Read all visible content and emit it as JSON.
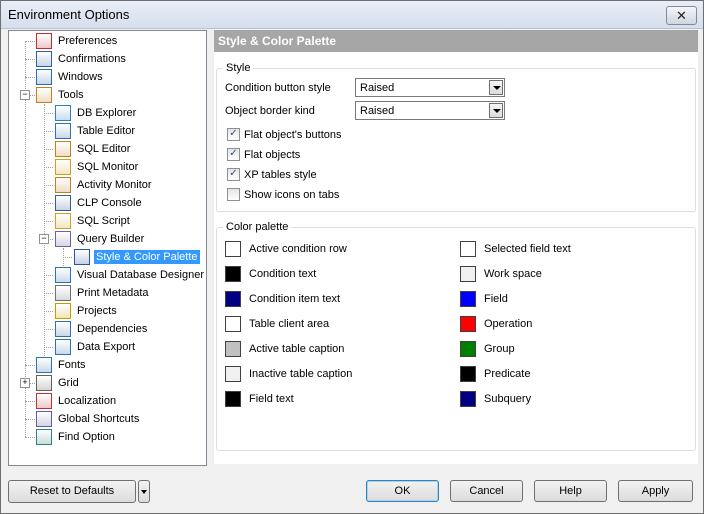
{
  "window": {
    "title": "Environment Options",
    "close_glyph": "✕"
  },
  "tree": {
    "items": [
      {
        "label": "Preferences",
        "icon": "preferences-icon"
      },
      {
        "label": "Confirmations",
        "icon": "confirmations-icon"
      },
      {
        "label": "Windows",
        "icon": "windows-icon"
      },
      {
        "label": "Tools",
        "icon": "tools-icon",
        "expanded": true
      },
      {
        "label": "DB Explorer",
        "icon": "db-explorer-icon"
      },
      {
        "label": "Table Editor",
        "icon": "table-editor-icon"
      },
      {
        "label": "SQL Editor",
        "icon": "sql-editor-icon"
      },
      {
        "label": "SQL Monitor",
        "icon": "sql-monitor-icon"
      },
      {
        "label": "Activity Monitor",
        "icon": "activity-monitor-icon"
      },
      {
        "label": "CLP Console",
        "icon": "clp-console-icon"
      },
      {
        "label": "SQL Script",
        "icon": "sql-script-icon"
      },
      {
        "label": "Query Builder",
        "icon": "query-builder-icon",
        "expanded": true
      },
      {
        "label": "Style & Color Palette",
        "icon": "palette-icon",
        "selected": true
      },
      {
        "label": "Visual Database Designer",
        "icon": "visual-designer-icon"
      },
      {
        "label": "Print Metadata",
        "icon": "print-metadata-icon"
      },
      {
        "label": "Projects",
        "icon": "projects-icon"
      },
      {
        "label": "Dependencies",
        "icon": "dependencies-icon"
      },
      {
        "label": "Data Export",
        "icon": "data-export-icon"
      },
      {
        "label": "Fonts",
        "icon": "fonts-icon"
      },
      {
        "label": "Grid",
        "icon": "grid-icon",
        "expanded": false
      },
      {
        "label": "Localization",
        "icon": "localization-icon"
      },
      {
        "label": "Global Shortcuts",
        "icon": "global-shortcuts-icon"
      },
      {
        "label": "Find Option",
        "icon": "find-option-icon"
      }
    ]
  },
  "panel": {
    "header": "Style & Color Palette",
    "style_group": {
      "label": "Style",
      "condition_button_style": {
        "label": "Condition button style",
        "value": "Raised"
      },
      "object_border_kind": {
        "label": "Object border kind",
        "value": "Raised"
      },
      "checkboxes": [
        {
          "label": "Flat object's buttons",
          "checked": true
        },
        {
          "label": "Flat objects",
          "checked": true
        },
        {
          "label": "XP tables style",
          "checked": true
        },
        {
          "label": "Show icons on tabs",
          "checked": false
        }
      ]
    },
    "palette_group": {
      "label": "Color palette",
      "left": [
        {
          "label": "Active condition row",
          "color": "#ffffff"
        },
        {
          "label": "Condition text",
          "color": "#000000"
        },
        {
          "label": "Condition item text",
          "color": "#000080"
        },
        {
          "label": "Table client area",
          "color": "#ffffff"
        },
        {
          "label": "Active table caption",
          "color": "#c0c0c0"
        },
        {
          "label": "Inactive table caption",
          "color": "#f0f0f0"
        },
        {
          "label": "Field text",
          "color": "#000000"
        }
      ],
      "right": [
        {
          "label": "Selected field text",
          "color": "#ffffff"
        },
        {
          "label": "Work space",
          "color": "#f0f0f0"
        },
        {
          "label": "Field",
          "color": "#0000ff"
        },
        {
          "label": "Operation",
          "color": "#ff0000"
        },
        {
          "label": "Group",
          "color": "#008000"
        },
        {
          "label": "Predicate",
          "color": "#000000"
        },
        {
          "label": "Subquery",
          "color": "#000080"
        }
      ]
    }
  },
  "buttons": {
    "reset": "Reset to Defaults",
    "ok": "OK",
    "cancel": "Cancel",
    "help": "Help",
    "apply": "Apply"
  }
}
